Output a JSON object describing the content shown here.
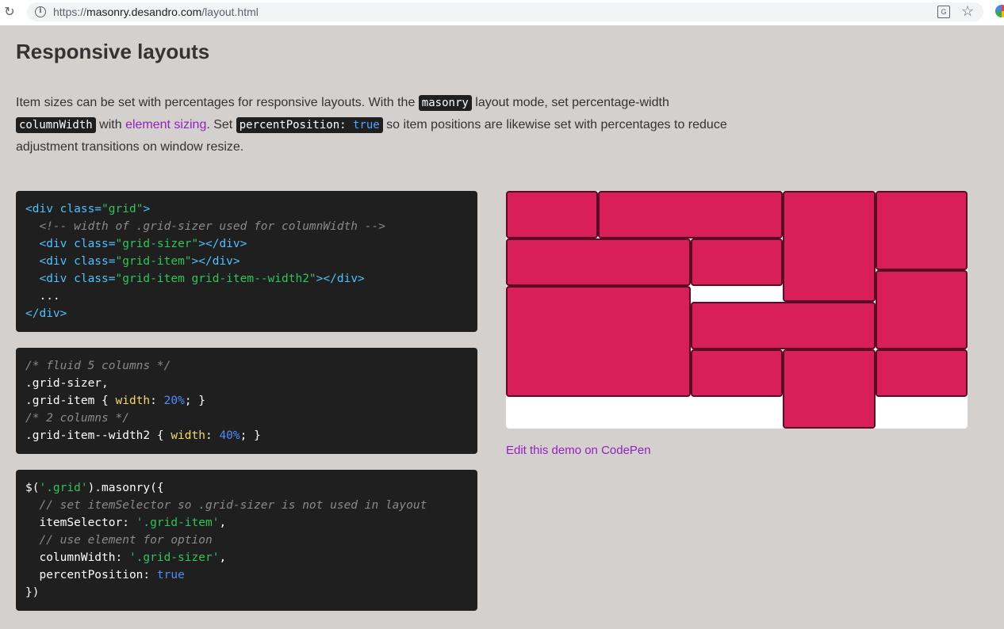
{
  "browser": {
    "url_scheme": "https://",
    "url_host": "masonry.desandro.com",
    "url_path": "/layout.html"
  },
  "section": {
    "title": "Responsive layouts",
    "intro": {
      "p1": "Item sizes can be set with percentages for responsive layouts. With the ",
      "code1": "masonry",
      "p2": " layout mode, set percentage-width ",
      "code2": "columnWidth",
      "p3": " with ",
      "link": "element sizing",
      "p4": ". Set ",
      "code3_a": "percentPosition: ",
      "code3_b": "true",
      "p5": " so item positions are likewise set with percentages to reduce adjustment transitions on window resize."
    }
  },
  "html_code": {
    "l1_open": "<div ",
    "l1_attr": "class=",
    "l1_str": "\"grid\"",
    "l1_close": ">",
    "l2_comment": "  <!-- width of .grid-sizer used for columnWidth -->",
    "l3_open": "  <div ",
    "l3_attr": "class=",
    "l3_str": "\"grid-sizer\"",
    "l3_close": "></div>",
    "l4_open": "  <div ",
    "l4_attr": "class=",
    "l4_str": "\"grid-item\"",
    "l4_close": "></div>",
    "l5_open": "  <div ",
    "l5_attr": "class=",
    "l5_str": "\"grid-item grid-item--width2\"",
    "l5_close": "></div>",
    "l6": "  ...",
    "l7": "</div>"
  },
  "css_code": {
    "l1_comment": "/* fluid 5 columns */",
    "l2": ".grid-sizer,",
    "l3_sel": ".grid-item { ",
    "l3_prop": "width",
    "l3_colon": ": ",
    "l3_num": "20%",
    "l3_end": "; }",
    "l4_comment": "/* 2 columns */",
    "l5_sel": ".grid-item--width2 { ",
    "l5_prop": "width",
    "l5_colon": ": ",
    "l5_num": "40%",
    "l5_end": "; }"
  },
  "js_code": {
    "l1_a": "$(",
    "l1_str": "'.grid'",
    "l1_b": ").masonry({",
    "l2_comment": "  // set itemSelector so .grid-sizer is not used in layout",
    "l3_key": "  itemSelector: ",
    "l3_str": "'.grid-item'",
    "l3_end": ",",
    "l4_comment": "  // use element for option",
    "l5_key": "  columnWidth: ",
    "l5_str": "'.grid-sizer'",
    "l5_end": ",",
    "l6_key": "  percentPosition: ",
    "l6_kw": "true",
    "l7": "})"
  },
  "demo": {
    "tile_color": "#d81f5a",
    "tile_border_color": "#5a0c27",
    "link_label": "Edit this demo on CodePen"
  },
  "colors": {
    "page_bg": "#d4d0cd",
    "code_bg": "#1f1f1f",
    "link": "#9420c2"
  }
}
